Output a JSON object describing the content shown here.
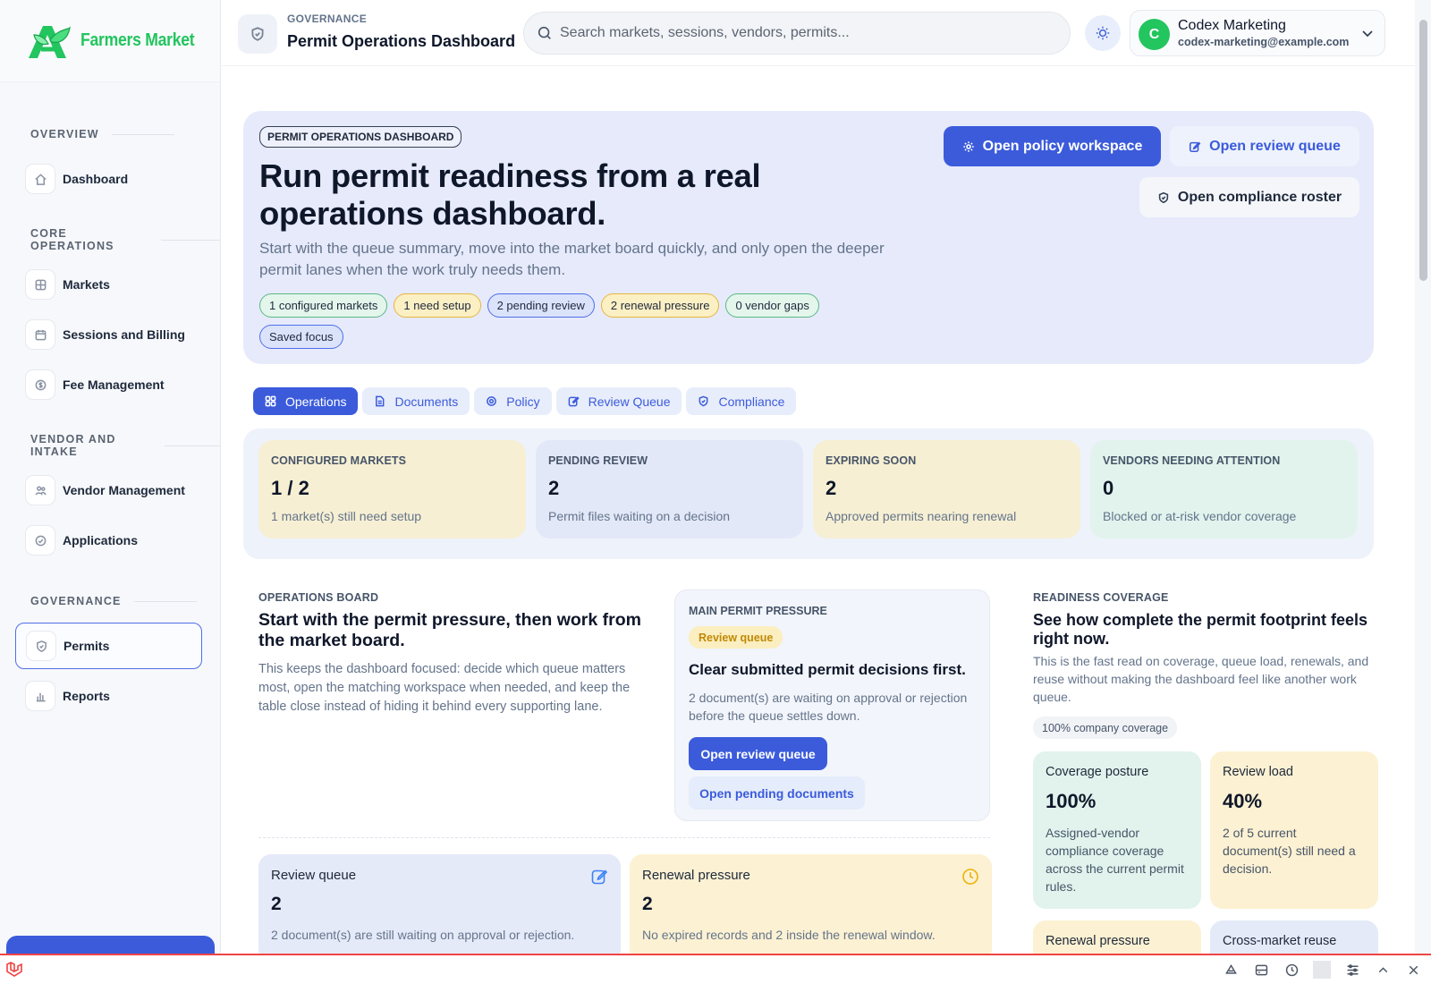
{
  "brand": {
    "name": "Farmers Market"
  },
  "sidebar": {
    "sections": [
      {
        "title": "OVERVIEW",
        "items": [
          {
            "label": "Dashboard",
            "icon": "home-icon"
          }
        ]
      },
      {
        "title": "CORE OPERATIONS",
        "items": [
          {
            "label": "Markets",
            "icon": "grid-icon"
          },
          {
            "label": "Sessions and Billing",
            "icon": "calendar-icon"
          },
          {
            "label": "Fee Management",
            "icon": "dollar-icon"
          }
        ]
      },
      {
        "title": "VENDOR AND INTAKE",
        "items": [
          {
            "label": "Vendor Management",
            "icon": "users-icon"
          },
          {
            "label": "Applications",
            "icon": "clipboard-icon"
          }
        ]
      },
      {
        "title": "GOVERNANCE",
        "items": [
          {
            "label": "Permits",
            "icon": "shield-icon",
            "active": true
          },
          {
            "label": "Reports",
            "icon": "bar-chart-icon"
          }
        ]
      }
    ]
  },
  "header": {
    "kicker": "GOVERNANCE",
    "title": "Permit Operations Dashboard",
    "search_placeholder": "Search markets, sessions, vendors, permits...",
    "user": {
      "initial": "C",
      "name": "Codex Marketing",
      "email": "codex-marketing@example.com"
    }
  },
  "hero": {
    "tag": "PERMIT OPERATIONS DASHBOARD",
    "title": "Run permit readiness from a real operations dashboard.",
    "subtitle": "Start with the queue summary, move into the market board quickly, and only open the deeper permit lanes when the work truly needs them.",
    "chips": [
      {
        "label": "1 configured markets",
        "tone": "green"
      },
      {
        "label": "1 need setup",
        "tone": "yellow"
      },
      {
        "label": "2 pending review",
        "tone": "blue"
      },
      {
        "label": "2 renewal pressure",
        "tone": "yellow"
      },
      {
        "label": "0 vendor gaps",
        "tone": "green"
      },
      {
        "label": "Saved focus",
        "tone": "blue"
      }
    ],
    "buttons": {
      "policy": "Open policy workspace",
      "review": "Open review queue",
      "compliance": "Open compliance roster"
    }
  },
  "tabs": [
    "Operations",
    "Documents",
    "Policy",
    "Review Queue",
    "Compliance"
  ],
  "stats": [
    {
      "label": "CONFIGURED MARKETS",
      "value": "1 / 2",
      "desc": "1 market(s) still need setup"
    },
    {
      "label": "PENDING REVIEW",
      "value": "2",
      "desc": "Permit files waiting on a decision"
    },
    {
      "label": "EXPIRING SOON",
      "value": "2",
      "desc": "Approved permits nearing renewal"
    },
    {
      "label": "VENDORS NEEDING ATTENTION",
      "value": "0",
      "desc": "Blocked or at-risk vendor coverage"
    }
  ],
  "ops_board": {
    "kicker": "OPERATIONS BOARD",
    "title": "Start with the permit pressure, then work from the market board.",
    "desc": "This keeps the dashboard focused: decide which queue matters most, open the matching workspace when needed, and keep the table close instead of hiding it behind every supporting lane."
  },
  "pressure": {
    "kicker": "MAIN PERMIT PRESSURE",
    "badge": "Review queue",
    "title": "Clear submitted permit decisions first.",
    "desc": "2 document(s) are waiting on approval or rejection before the queue settles down.",
    "primary_btn": "Open review queue",
    "secondary_btn": "Open pending documents"
  },
  "mini_cards": [
    {
      "title": "Review queue",
      "value": "2",
      "desc": "2 document(s) are still waiting on approval or rejection."
    },
    {
      "title": "Renewal pressure",
      "value": "2",
      "desc": "No expired records and 2 inside the renewal window."
    }
  ],
  "readiness": {
    "kicker": "READINESS COVERAGE",
    "title": "See how complete the permit footprint feels right now.",
    "desc": "This is the fast read on coverage, queue load, renewals, and reuse without making the dashboard feel like another work queue.",
    "chip": "100% company coverage",
    "cards": [
      {
        "title": "Coverage posture",
        "value": "100%",
        "desc": "Assigned-vendor compliance coverage across the current permit rules."
      },
      {
        "title": "Review load",
        "value": "40%",
        "desc": "2 of 5 current document(s) still need a decision."
      },
      {
        "title": "Renewal pressure",
        "value": "",
        "desc": ""
      },
      {
        "title": "Cross-market reuse",
        "value": "",
        "desc": ""
      }
    ]
  }
}
